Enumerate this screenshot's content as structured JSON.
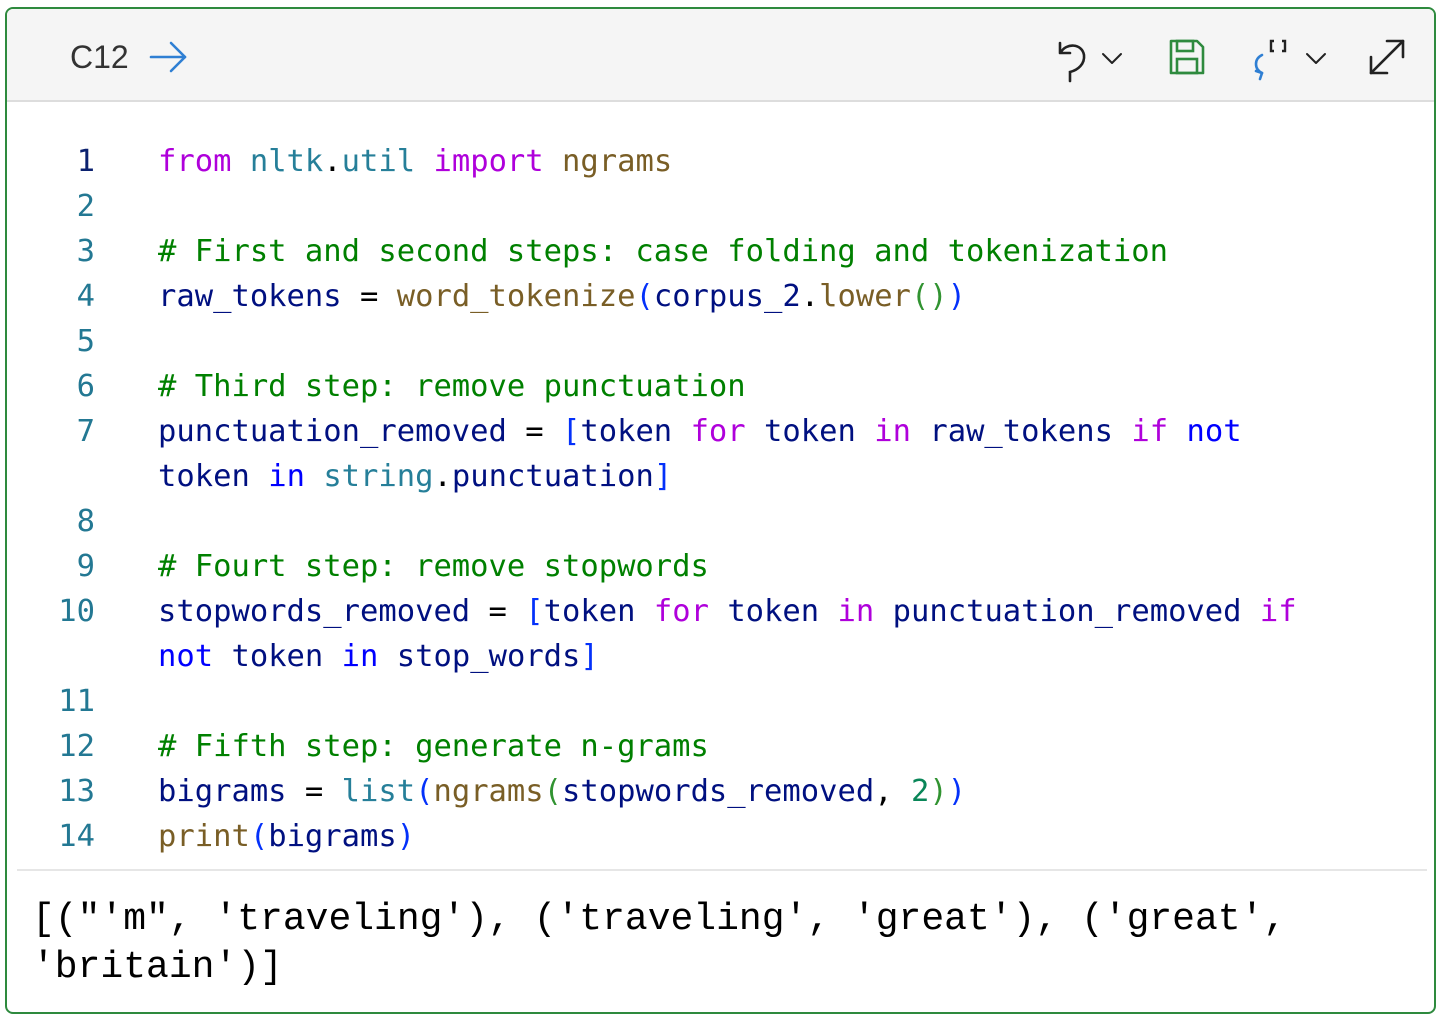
{
  "header": {
    "cell_ref": "C12",
    "icons": {
      "go_to": "arrow-right-icon",
      "undo": "undo-icon",
      "undo_menu": "chevron-down-icon",
      "save": "save-icon",
      "reset": "reset-bracket-icon",
      "reset_menu": "chevron-down-icon",
      "expand": "expand-diagonal-icon"
    },
    "colors": {
      "accent": "#2e8a3e",
      "arrow": "#2f7fd3"
    }
  },
  "editor": {
    "lines": [
      {
        "n": "1",
        "tokens": [
          [
            "kw",
            "from"
          ],
          [
            "pl",
            " "
          ],
          [
            "bt",
            "nltk"
          ],
          [
            "pl",
            "."
          ],
          [
            "bt",
            "util"
          ],
          [
            "pl",
            " "
          ],
          [
            "kw",
            "import"
          ],
          [
            "pl",
            " "
          ],
          [
            "fn",
            "ngrams"
          ]
        ]
      },
      {
        "n": "2",
        "tokens": []
      },
      {
        "n": "3",
        "tokens": [
          [
            "cm",
            "# First and second steps: case folding and tokenization"
          ]
        ]
      },
      {
        "n": "4",
        "tokens": [
          [
            "var",
            "raw_tokens"
          ],
          [
            "pl",
            " = "
          ],
          [
            "fn",
            "word_tokenize"
          ],
          [
            "br1",
            "("
          ],
          [
            "var",
            "corpus_2"
          ],
          [
            "pl",
            "."
          ],
          [
            "fn",
            "lower"
          ],
          [
            "br2",
            "()"
          ],
          [
            "br1",
            ")"
          ]
        ]
      },
      {
        "n": "5",
        "tokens": []
      },
      {
        "n": "6",
        "tokens": [
          [
            "cm",
            "# Third step: remove punctuation"
          ]
        ]
      },
      {
        "n": "7",
        "tokens": [
          [
            "var",
            "punctuation_removed"
          ],
          [
            "pl",
            " = "
          ],
          [
            "br1",
            "["
          ],
          [
            "var",
            "token"
          ],
          [
            "pl",
            " "
          ],
          [
            "kw",
            "for"
          ],
          [
            "pl",
            " "
          ],
          [
            "var",
            "token"
          ],
          [
            "pl",
            " "
          ],
          [
            "kw",
            "in"
          ],
          [
            "pl",
            " "
          ],
          [
            "var",
            "raw_tokens"
          ],
          [
            "pl",
            " "
          ],
          [
            "kw",
            "if"
          ],
          [
            "pl",
            " "
          ],
          [
            "kw2",
            "not"
          ]
        ]
      },
      {
        "n": "",
        "tokens": [
          [
            "var",
            "token"
          ],
          [
            "pl",
            " "
          ],
          [
            "kw2",
            "in"
          ],
          [
            "pl",
            " "
          ],
          [
            "bt",
            "string"
          ],
          [
            "pl",
            "."
          ],
          [
            "var",
            "punctuation"
          ],
          [
            "br1",
            "]"
          ]
        ]
      },
      {
        "n": "8",
        "tokens": []
      },
      {
        "n": "9",
        "tokens": [
          [
            "cm",
            "# Fourt step: remove stopwords"
          ]
        ]
      },
      {
        "n": "10",
        "tokens": [
          [
            "var",
            "stopwords_removed"
          ],
          [
            "pl",
            " = "
          ],
          [
            "br1",
            "["
          ],
          [
            "var",
            "token"
          ],
          [
            "pl",
            " "
          ],
          [
            "kw",
            "for"
          ],
          [
            "pl",
            " "
          ],
          [
            "var",
            "token"
          ],
          [
            "pl",
            " "
          ],
          [
            "kw",
            "in"
          ],
          [
            "pl",
            " "
          ],
          [
            "var",
            "punctuation_removed"
          ],
          [
            "pl",
            " "
          ],
          [
            "kw",
            "if"
          ]
        ]
      },
      {
        "n": "",
        "tokens": [
          [
            "kw2",
            "not"
          ],
          [
            "pl",
            " "
          ],
          [
            "var",
            "token"
          ],
          [
            "pl",
            " "
          ],
          [
            "kw2",
            "in"
          ],
          [
            "pl",
            " "
          ],
          [
            "var",
            "stop_words"
          ],
          [
            "br1",
            "]"
          ]
        ]
      },
      {
        "n": "11",
        "tokens": []
      },
      {
        "n": "12",
        "tokens": [
          [
            "cm",
            "# Fifth step: generate n-grams"
          ]
        ]
      },
      {
        "n": "13",
        "tokens": [
          [
            "var",
            "bigrams"
          ],
          [
            "pl",
            " = "
          ],
          [
            "bt",
            "list"
          ],
          [
            "br1",
            "("
          ],
          [
            "fn",
            "ngrams"
          ],
          [
            "br2",
            "("
          ],
          [
            "var",
            "stopwords_removed"
          ],
          [
            "pl",
            ", "
          ],
          [
            "nm",
            "2"
          ],
          [
            "br2",
            ")"
          ],
          [
            "br1",
            ")"
          ]
        ]
      },
      {
        "n": "14",
        "tokens": [
          [
            "fn",
            "print"
          ],
          [
            "br1",
            "("
          ],
          [
            "var",
            "bigrams"
          ],
          [
            "br1",
            ")"
          ]
        ]
      }
    ]
  },
  "output": {
    "lines": [
      "[(\"'m\", 'traveling'), ('traveling', 'great'), ('great',",
      "'britain')]"
    ]
  }
}
